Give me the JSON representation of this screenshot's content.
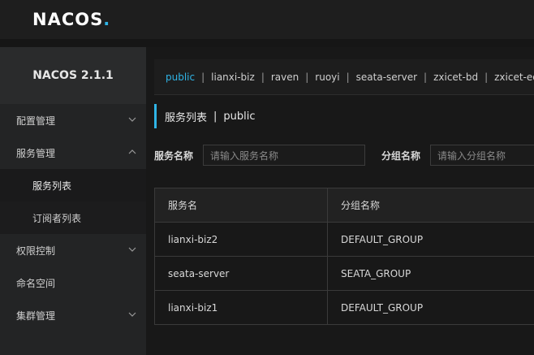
{
  "brand": {
    "logo_text": "NACOS",
    "logo_dot": ".",
    "accent": "#2fb4e6"
  },
  "sidebar": {
    "version": "NACOS 2.1.1",
    "items": [
      {
        "label": "配置管理",
        "chevron": "down"
      },
      {
        "label": "服务管理",
        "chevron": "up"
      },
      {
        "label": "服务列表"
      },
      {
        "label": "订阅者列表"
      },
      {
        "label": "权限控制",
        "chevron": "down"
      },
      {
        "label": "命名空间"
      },
      {
        "label": "集群管理",
        "chevron": "down"
      }
    ]
  },
  "namespaces": [
    {
      "label": "public",
      "active": true
    },
    {
      "label": "lianxi-biz"
    },
    {
      "label": "raven"
    },
    {
      "label": "ruoyi"
    },
    {
      "label": "seata-server"
    },
    {
      "label": "zxicet-bd"
    },
    {
      "label": "zxicet-ed"
    }
  ],
  "namespace_separator": "|",
  "page": {
    "title": "服务列表",
    "separator": "|",
    "namespace": "public"
  },
  "filters": {
    "service_name_label": "服务名称",
    "service_name_placeholder": "请输入服务名称",
    "group_name_label": "分组名称",
    "group_name_placeholder": "请输入分组名称"
  },
  "table": {
    "headers": [
      "服务名",
      "分组名称"
    ],
    "rows": [
      [
        "lianxi-biz2",
        "DEFAULT_GROUP"
      ],
      [
        "seata-server",
        "SEATA_GROUP"
      ],
      [
        "lianxi-biz1",
        "DEFAULT_GROUP"
      ]
    ]
  }
}
